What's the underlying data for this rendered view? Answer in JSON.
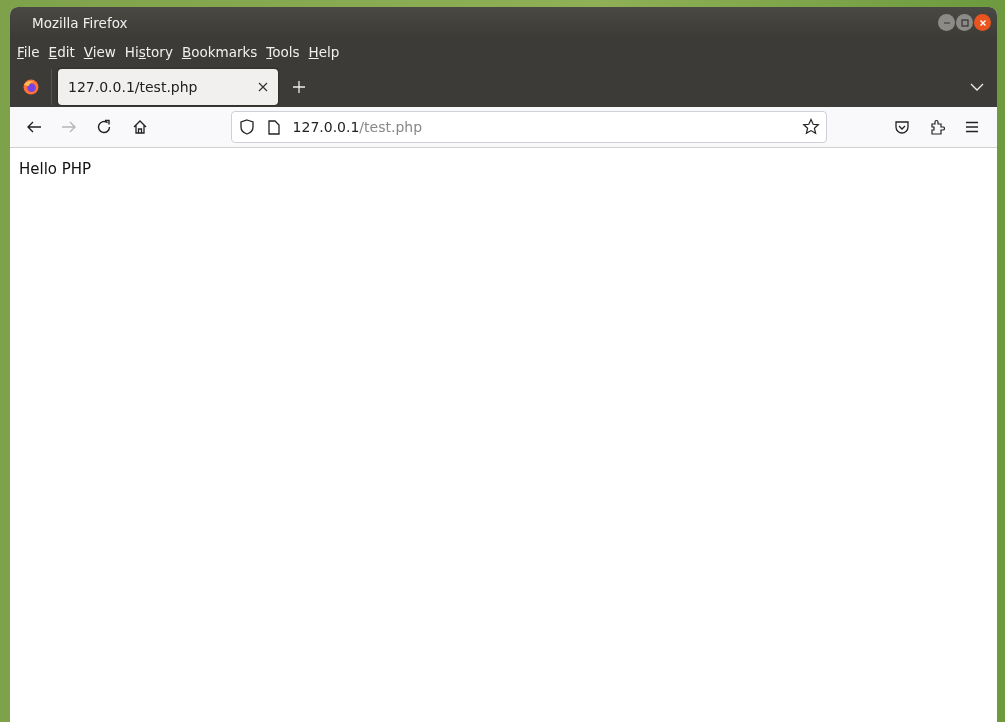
{
  "window": {
    "title": "Mozilla Firefox"
  },
  "menu": [
    {
      "key": "F",
      "after": "ile"
    },
    {
      "key": "E",
      "after": "dit"
    },
    {
      "key": "V",
      "after": "iew"
    },
    {
      "before": "Hi",
      "key": "s",
      "after": "tory"
    },
    {
      "key": "B",
      "after": "ookmarks"
    },
    {
      "key": "T",
      "after": "ools"
    },
    {
      "key": "H",
      "after": "elp"
    }
  ],
  "tabs": [
    {
      "label": "127.0.0.1/test.php",
      "selected": true
    }
  ],
  "address": {
    "host": "127.0.0.1",
    "path": "/test.php"
  },
  "nav": {
    "back_disabled": false,
    "forward_disabled": true
  },
  "page": {
    "text": "Hello PHP"
  }
}
